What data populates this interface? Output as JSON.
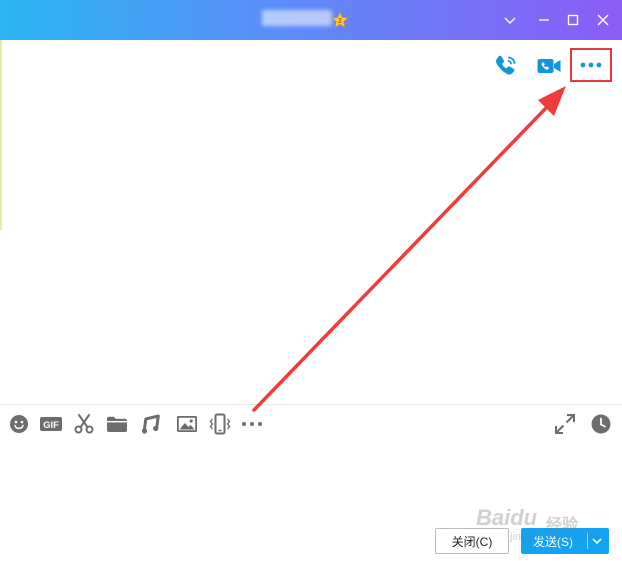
{
  "window": {
    "title_obscured": true,
    "controls": [
      "minimize",
      "maximize",
      "close"
    ],
    "colors": {
      "title_gradient_start": "#29b6f6",
      "title_gradient_end": "#8b5cf6",
      "accent_blue": "#12a3f5",
      "highlight_red": "#e8383d"
    }
  },
  "top_actions": [
    {
      "name": "voice-call",
      "icon": "phone-icon"
    },
    {
      "name": "video-call",
      "icon": "video-camera-icon"
    },
    {
      "name": "more",
      "icon": "more-dots-icon",
      "highlighted": true
    }
  ],
  "toolbar": {
    "tools": [
      {
        "icon": "emoji-icon"
      },
      {
        "icon": "gif-icon",
        "label": "GIF"
      },
      {
        "icon": "scissors-icon"
      },
      {
        "icon": "folder-icon"
      },
      {
        "icon": "music-note-icon"
      },
      {
        "icon": "image-icon"
      },
      {
        "icon": "phone-shake-icon"
      },
      {
        "icon": "more-dots-icon"
      }
    ],
    "right_tools": [
      {
        "icon": "expand-icon"
      },
      {
        "icon": "clock-history-icon"
      }
    ]
  },
  "buttons": {
    "close_label": "关闭(C)",
    "send_label": "发送(S)"
  },
  "watermark": {
    "main": "Baidu",
    "sub": "经验",
    "url": "jingyan.baidu.com"
  }
}
